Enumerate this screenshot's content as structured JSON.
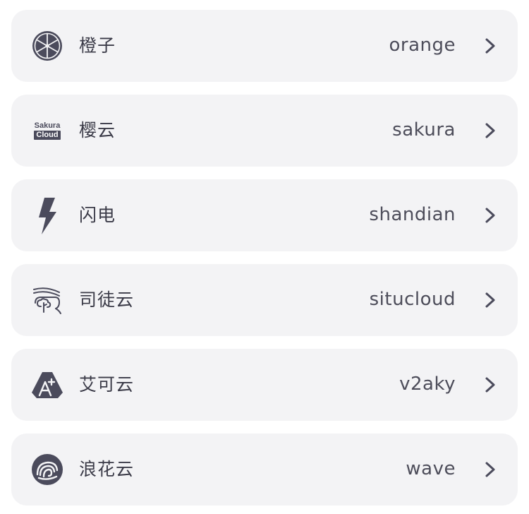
{
  "colors": {
    "card_background": "#f3f3f5",
    "icon": "#4b4b5c",
    "text": "#3b3b48",
    "chevron": "#4b4b5c"
  },
  "items": [
    {
      "icon": "orange-slice-icon",
      "name": "橙子",
      "code": "orange"
    },
    {
      "icon": "sakura-cloud-logo",
      "name": "樱云",
      "code": "sakura",
      "logo_top": "Sakura",
      "logo_bottom": "Cloud"
    },
    {
      "icon": "lightning-bolt-icon",
      "name": "闪电",
      "code": "shandian"
    },
    {
      "icon": "cloud-wave-icon",
      "name": "司徒云",
      "code": "situcloud"
    },
    {
      "icon": "triangle-a-icon",
      "name": "艾可云",
      "code": "v2aky"
    },
    {
      "icon": "wave-circle-icon",
      "name": "浪花云",
      "code": "wave"
    }
  ]
}
